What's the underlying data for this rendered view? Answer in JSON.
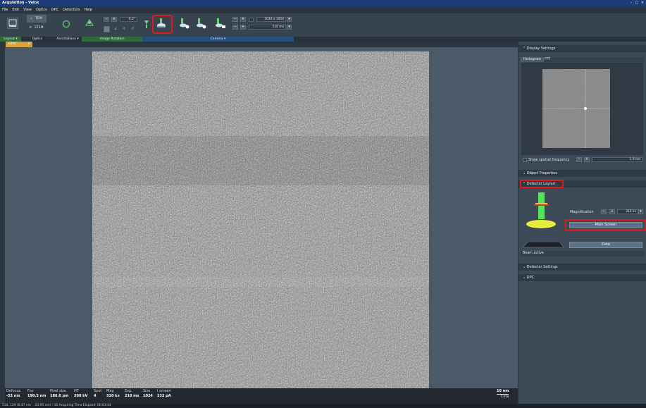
{
  "window": {
    "title": "Acquisition - Velox"
  },
  "menu": [
    "File",
    "Edit",
    "View",
    "Optics",
    "DPC",
    "Detectors",
    "Help"
  ],
  "ribbon": {
    "tem_label": "TEM",
    "stem_label": "STEM",
    "rotation_value": "0.2°",
    "frame_size": "1024 x 1024",
    "exposure": "210 ms",
    "groups": [
      "Layout ▾",
      "Optics",
      "Annotations ▾",
      "Image Rotation",
      "Camera ▾"
    ]
  },
  "tabs": {
    "image_tab": "Ceta"
  },
  "status": {
    "defocus": {
      "label": "Defocus",
      "value": "-53 nm"
    },
    "fov": {
      "label": "Fov",
      "value": "190.5 nm"
    },
    "pixel_size": {
      "label": "Pixel size",
      "value": "186.0 pm"
    },
    "ht": {
      "label": "HT",
      "value": "200 kV"
    },
    "spot": {
      "label": "Spot",
      "value": "4"
    },
    "mag": {
      "label": "Mag",
      "value": "310 kx"
    },
    "exp": {
      "label": "Exp",
      "value": "210 ms"
    },
    "size": {
      "label": "Size",
      "value": "1024"
    },
    "screen": {
      "label": "I screen",
      "value": "232 pA"
    },
    "scalebar": "10 nm",
    "detector": "Ceta"
  },
  "footer": {
    "text": "514, 129 (0.47 nm , -33.95 nm) / 10   Acquiring Time Elapsed: 00:03:44"
  },
  "panel": {
    "display_settings": "Display Settings",
    "histogram_tab": "Histogram",
    "fft_tab": "FFT",
    "show_spatial_frequency": "Show spatial frequency",
    "spatial_value": "1.0 nm",
    "object_properties": "Object Properties",
    "detector_layout": "Detector Layout",
    "magnification_label": "Magnification",
    "magnification_value": "310 kx",
    "main_screen_button": "Main Screen",
    "ceta_button": "Ceta",
    "beam_active": "Beam active",
    "detector_settings": "Detector Settings",
    "dpc": "DPC"
  },
  "colors": {
    "accent_red": "#e0191d",
    "titlebar": "#1d3c79",
    "ribbon_group_green": "#2f6a3a",
    "ribbon_group_blue": "#274f7c",
    "tab_orange": "#d7a33d"
  }
}
